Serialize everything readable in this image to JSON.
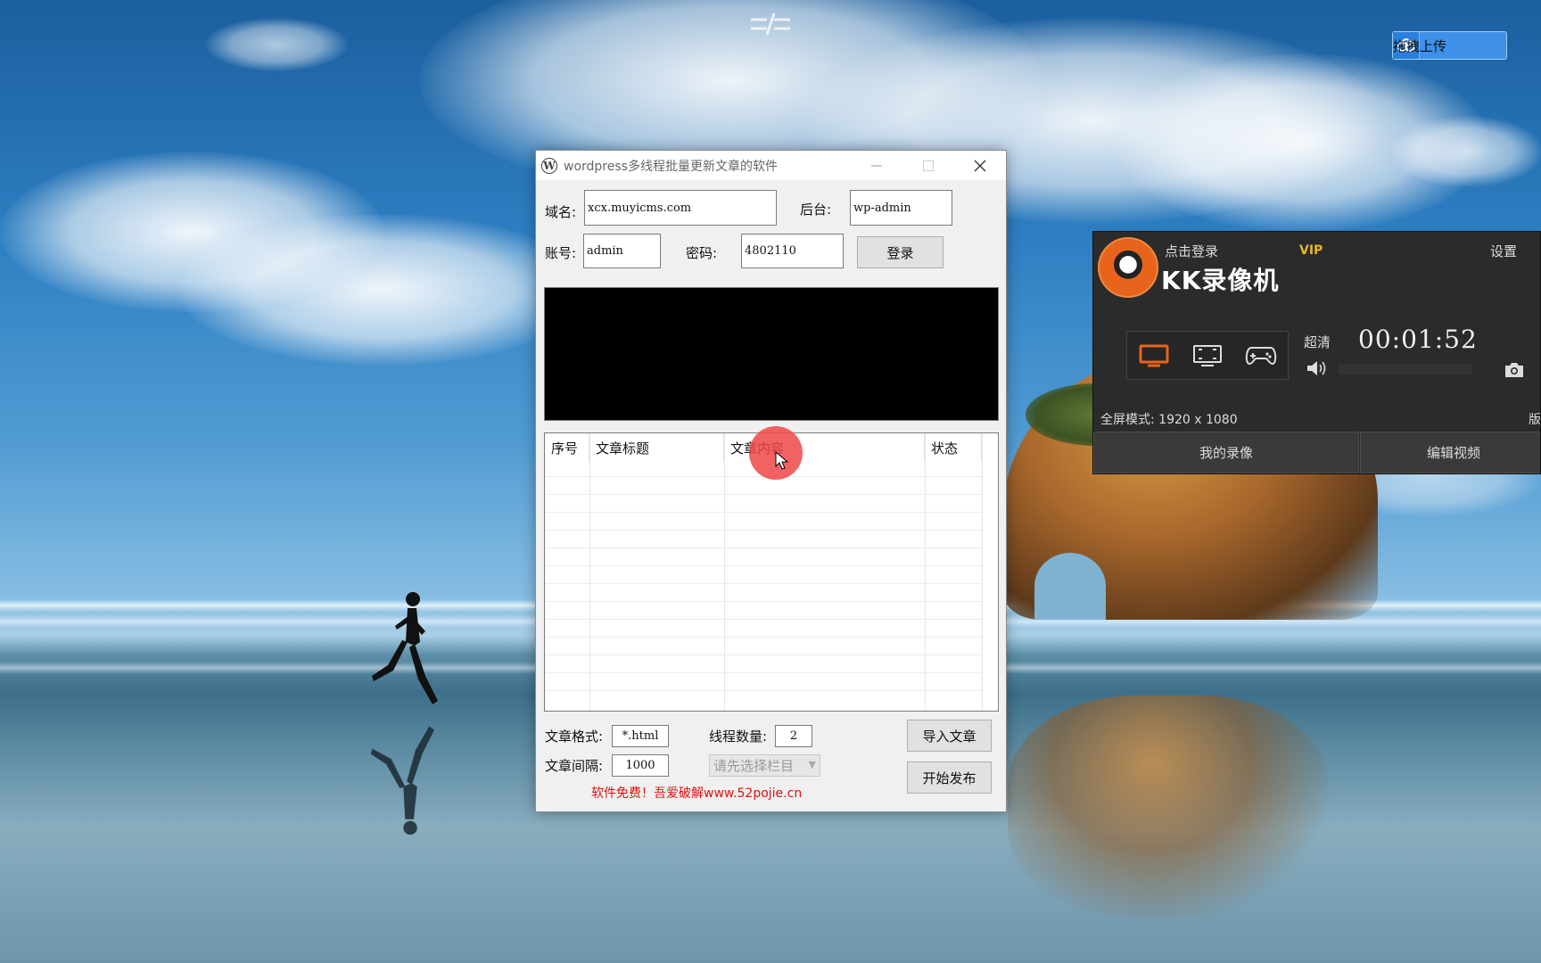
{
  "upload_badge": {
    "label": "拖拽上传"
  },
  "app": {
    "title": "wordpress多线程批量更新文章的软件",
    "domain_label": "域名:",
    "domain_value": "xcx.muyicms.com",
    "backend_label": "后台:",
    "backend_value": "wp-admin",
    "account_label": "账号:",
    "account_value": "admin",
    "password_label": "密码:",
    "password_value": "4802110",
    "login_button": "登录",
    "table": {
      "columns": [
        "序号",
        "文章标题",
        "文章内容",
        "状态"
      ],
      "rows": []
    },
    "format_label": "文章格式:",
    "format_value": "*.html",
    "threads_label": "线程数量:",
    "threads_value": "2",
    "interval_label": "文章间隔:",
    "interval_value": "1000",
    "category_select": "请先选择栏目",
    "import_button": "导入文章",
    "publish_button": "开始发布",
    "footer_note": "软件免费！吾爱破解www.52pojie.cn"
  },
  "recorder": {
    "login_link": "点击登录",
    "vip": "VIP",
    "settings": "设置",
    "brand": "KK录像机",
    "quality": "超清",
    "timer": "00:01:52",
    "mode_info": "全屏模式: 1920 x 1080",
    "version_stub": "版",
    "tab_my_videos": "我的录像",
    "tab_edit_video": "编辑视频",
    "modes": [
      "screen-mode-icon",
      "region-mode-icon",
      "game-mode-icon"
    ],
    "accent_color": "#e8641c"
  }
}
